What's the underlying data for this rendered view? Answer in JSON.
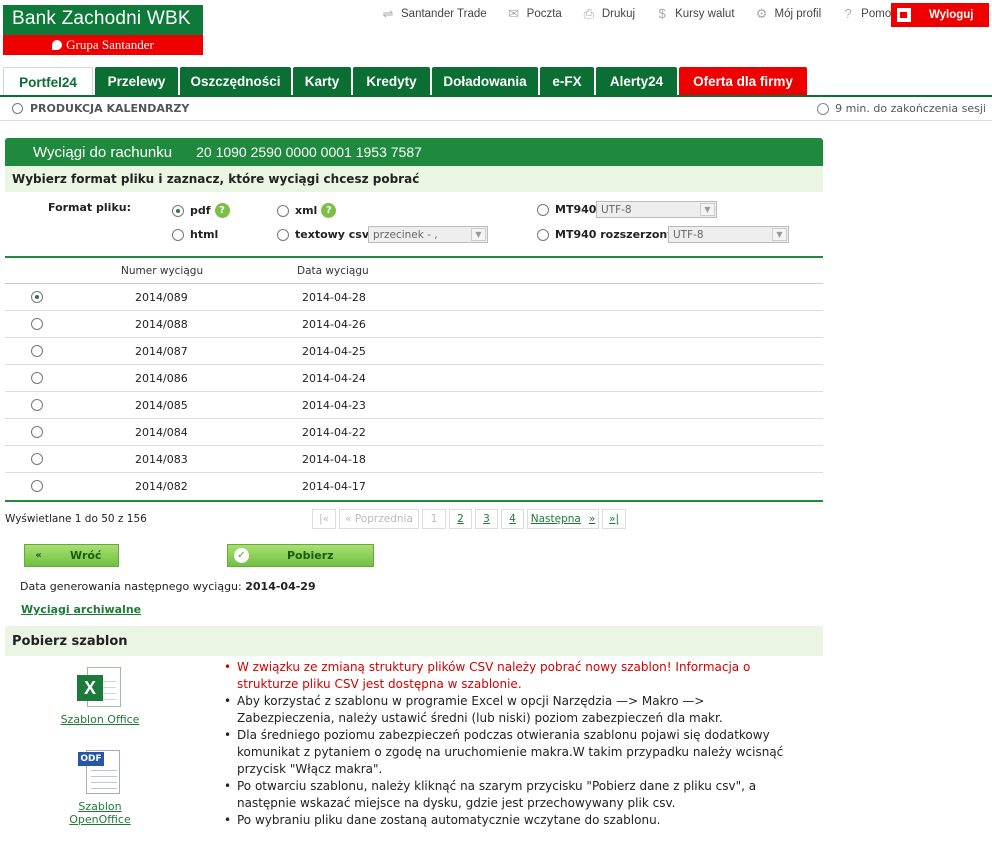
{
  "logo": {
    "title": "Bank Zachodni WBK",
    "subtitle": "Grupa Santander"
  },
  "toplinks": [
    {
      "label": "Santander Trade",
      "icon": "handshake-icon"
    },
    {
      "label": "Poczta",
      "icon": "envelope-icon"
    },
    {
      "label": "Drukuj",
      "icon": "printer-icon"
    },
    {
      "label": "Kursy walut",
      "icon": "currency-icon"
    },
    {
      "label": "Mój profil",
      "icon": "gear-icon"
    },
    {
      "label": "Pomoc",
      "icon": "help-icon"
    }
  ],
  "logout": "Wyloguj",
  "tabs": [
    "Portfel24",
    "Przelewy",
    "Oszczędności",
    "Karty",
    "Kredyty",
    "Doładowania",
    "e-FX",
    "Alerty24",
    "Oferta dla firmy"
  ],
  "breadcrumb": "PRODUKCJA KALENDARZY",
  "session": "9 min. do zakończenia sesji",
  "panel": {
    "title": "Wyciągi do rachunku",
    "account": "20 1090 2590 0000 0001 1953 7587",
    "subtitle": "Wybierz format pliku i zaznacz, które wyciągi chcesz pobrać"
  },
  "format": {
    "label": "Format pliku:",
    "options": {
      "pdf": "pdf",
      "html": "html",
      "xml": "xml",
      "csv": "textowy csv",
      "mt940": "MT940",
      "mt940ext": "MT940 rozszerzony"
    },
    "help": "?",
    "csv_select": "przecinek - ,",
    "mt940_select": "UTF-8",
    "mt940ext_select": "UTF-8",
    "selected": "pdf"
  },
  "table": {
    "headers": {
      "number": "Numer wyciągu",
      "date": "Data wyciągu"
    },
    "rows": [
      {
        "number": "2014/089",
        "date": "2014-04-28"
      },
      {
        "number": "2014/088",
        "date": "2014-04-26"
      },
      {
        "number": "2014/087",
        "date": "2014-04-25"
      },
      {
        "number": "2014/086",
        "date": "2014-04-24"
      },
      {
        "number": "2014/085",
        "date": "2014-04-23"
      },
      {
        "number": "2014/084",
        "date": "2014-04-22"
      },
      {
        "number": "2014/083",
        "date": "2014-04-18"
      },
      {
        "number": "2014/082",
        "date": "2014-04-17"
      }
    ],
    "shown": "Wyświetlane 1 do 50 z 156"
  },
  "pager": {
    "first": "|«",
    "prev": "« Poprzednia",
    "p1": "1",
    "p2": "2",
    "p3": "3",
    "p4": "4",
    "next": "Następna",
    "next_arrow": "»",
    "last": "»|"
  },
  "buttons": {
    "back": "Wróć",
    "back_icon": "«",
    "download": "Pobierz",
    "download_icon": "✓"
  },
  "next_statement": {
    "label": "Data generowania następnego wyciągu:",
    "date": "2014-04-29"
  },
  "archive_link": "Wyciągi archiwalne",
  "template": {
    "title": "Pobierz szablon",
    "office": "Szablon Office",
    "openoffice": "Szablon OpenOffice",
    "office_glyph": "X",
    "openoffice_glyph": "ODF",
    "notes": [
      "W związku ze zmianą struktury plików CSV należy pobrać nowy szablon! Informacja o strukturze pliku CSV jest dostępna w szablonie.",
      "Aby korzystać z szablonu w programie Excel w opcji Narzędzia —> Makro —> Zabezpieczenia, należy ustawić średni (lub niski) poziom zabezpieczeń dla makr.",
      "Dla średniego poziomu zabezpieczeń podczas otwierania szablonu pojawi się dodatkowy komunikat z pytaniem o zgodę na uruchomienie makra.W takim przypadku należy wcisnąć przycisk \"Włącz makra\".",
      "Po otwarciu szablonu, należy kliknąć na szarym przycisku \"Pobierz dane z pliku csv\", a następnie wskazać miejsce na dysku, gdzie jest przechowywany plik csv.",
      "Po wybraniu pliku dane zostaną automatycznie wczytane do szablonu."
    ]
  },
  "colors": {
    "brand_green": "#0b6e33",
    "brand_red": "#e00000",
    "light_green": "#eaf5e3"
  }
}
